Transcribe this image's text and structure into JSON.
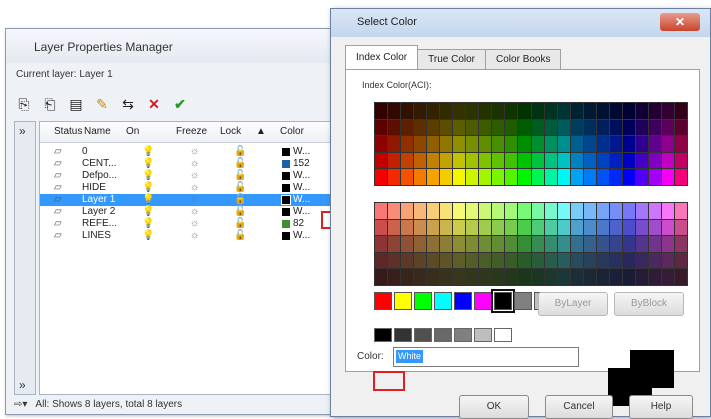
{
  "layer_manager": {
    "title": "Layer Properties Manager",
    "current_layer": "Current layer: Layer 1",
    "columns": [
      "Status",
      "Name",
      "On",
      "Freeze",
      "Lock",
      "Color"
    ],
    "sort_indicator": "▲",
    "layers": [
      {
        "name": "0",
        "color_text": "W...",
        "color_hex": "#000000"
      },
      {
        "name": "CENT...",
        "color_text": "152",
        "color_hex": "#1f5fa8"
      },
      {
        "name": "Defpo...",
        "color_text": "W...",
        "color_hex": "#000000"
      },
      {
        "name": "HIDE",
        "color_text": "W...",
        "color_hex": "#000000"
      },
      {
        "name": "Layer 1",
        "color_text": "W...",
        "color_hex": "#000000",
        "selected": true
      },
      {
        "name": "Layer 2",
        "color_text": "W...",
        "color_hex": "#000000"
      },
      {
        "name": "REFE...",
        "color_text": "82",
        "color_hex": "#3f8f2f"
      },
      {
        "name": "LINES",
        "color_text": "W...",
        "color_hex": "#000000"
      }
    ],
    "footer_text": "All: Shows 8 layers, total 8 layers"
  },
  "select_color": {
    "title": "Select Color",
    "close_label": "✕",
    "tabs": [
      "Index Color",
      "True Color",
      "Color Books"
    ],
    "aci_label": "Index Color(ACI):",
    "bylayer_label": "ByLayer",
    "byblock_label": "ByBlock",
    "color_label": "Color:",
    "color_value": "White",
    "ok_label": "OK",
    "cancel_label": "Cancel",
    "help_label": "Help",
    "standard_colors": [
      "#ff0000",
      "#ffff00",
      "#00ff00",
      "#00ffff",
      "#0000ff",
      "#ff00ff",
      "#000000",
      "#808080",
      "#c0c0c0"
    ],
    "gray_colors": [
      "#000000",
      "#333333",
      "#505050",
      "#696969",
      "#808080",
      "#bebebe",
      "#ffffff"
    ]
  }
}
